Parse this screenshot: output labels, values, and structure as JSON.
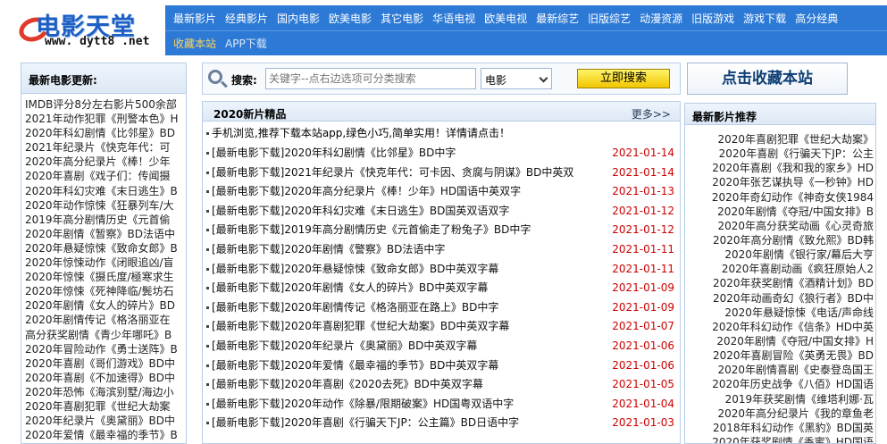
{
  "logo": {
    "cn": "电影天堂",
    "en": "www. dytt8 .net"
  },
  "topnav": [
    "最新影片",
    "经典影片",
    "国内电影",
    "欧美电影",
    "其它电影",
    "华语电视",
    "欧美电视",
    "最新综艺",
    "旧版综艺",
    "动漫资源",
    "旧版游戏",
    "游戏下载",
    "高分经典"
  ],
  "subnav": {
    "favorite": "收藏本站",
    "app": "APP下载"
  },
  "left": {
    "title": "最新电影更新:",
    "items": [
      "IMDB评分8分左右影片500余部",
      "2021年动作犯罪《刑警本色》H",
      "2020年科幻剧情《比邻星》BD",
      "2021年纪录片《快克年代：可",
      "2020年高分纪录片《棒！少年",
      "2020年喜剧《戏子们：传闻摄",
      "2020年科幻灾难《末日逃生》B",
      "2020年动作惊悚《狂暴列车/大",
      "2019年高分剧情历史《元首偷",
      "2020年剧情《暂察》BD法语中",
      "2020年悬疑惊悚《致命女郎》B",
      "2020年惊悚动作《闭眼追凶/盲",
      "2020年惊悚《摄氏度/極寒求生",
      "2020年惊悚《死神降临/鬓坊石",
      "2020年剧情《女人的碎片》BD",
      "2020年剧情传记《格洛丽亚在",
      "高分获奖剧情《青少年哪吒》B",
      "2020年冒险动作《勇士送阵》B",
      "2020年喜剧《哥们游戏》BD中",
      "2020年喜剧《不加速得》BD中",
      "2020年恐怖《海滨别墅/海边小",
      "2020年喜剧犯罪《世纪大劫案",
      "2020年纪录片《奥黛丽》BD中",
      "2020年爱情《最幸福的季节》B",
      "2020年喜剧《2020去死》BD"
    ]
  },
  "search": {
    "label": "搜索:",
    "placeholder": "关键字--点右边选项可分类搜索",
    "category": "电影",
    "button": "立即搜索"
  },
  "main": {
    "title": "2020新片精品",
    "more": "更多>>",
    "promo": "手机浏览,推荐下载本站app,绿色小巧,简单实用！详情请点击！",
    "rows": [
      {
        "text": "[最新电影下载]2020年科幻剧情《比邻星》BD中字",
        "date": "2021-01-14"
      },
      {
        "text": "[最新电影下载]2021年纪录片《快克年代：可卡因、贪腐与阴谋》BD中英双",
        "date": "2021-01-14"
      },
      {
        "text": "[最新电影下载]2020年高分纪录片《棒！少年》HD国语中英双字",
        "date": "2021-01-13"
      },
      {
        "text": "[最新电影下载]2020年科幻灾难《末日逃生》BD国英双语双字",
        "date": "2021-01-12"
      },
      {
        "text": "[最新电影下载]2019年高分剧情历史《元首偷走了粉兔子》BD中字",
        "date": "2021-01-12"
      },
      {
        "text": "[最新电影下载]2020年剧情《警察》BD法语中字",
        "date": "2021-01-11"
      },
      {
        "text": "[最新电影下载]2020年悬疑惊悚《致命女郎》BD中英双字幕",
        "date": "2021-01-11"
      },
      {
        "text": "[最新电影下载]2020年剧情《女人的碎片》BD中英双字幕",
        "date": "2021-01-09"
      },
      {
        "text": "[最新电影下载]2020年剧情传记《格洛丽亚在路上》BD中字",
        "date": "2021-01-09"
      },
      {
        "text": "[最新电影下载]2020年喜剧犯罪《世纪大劫案》BD中英双字幕",
        "date": "2021-01-07"
      },
      {
        "text": "[最新电影下载]2020年纪录片《奥黛丽》BD中英双字幕",
        "date": "2021-01-06"
      },
      {
        "text": "[最新电影下载]2020年爱情《最幸福的季节》BD中英双字幕",
        "date": "2021-01-06"
      },
      {
        "text": "[最新电影下载]2020年喜剧《2020去死》BD中英双字幕",
        "date": "2021-01-05"
      },
      {
        "text": "[最新电影下载]2020年动作《除暴/限期破案》HD国粤双语中字",
        "date": "2021-01-04"
      },
      {
        "text": "[最新电影下载]2020年喜剧《行骗天下JP：公主篇》BD日语中字",
        "date": "2021-01-03"
      }
    ]
  },
  "bookmark_button": "点击收藏本站",
  "right": {
    "title": "最新影片推荐",
    "items": [
      "2020年喜剧犯罪《世纪大劫案》",
      "2020年喜剧《行骗天下JP：公主",
      "2020年喜剧《我和我的家乡》HD",
      "2020年张艺谋执导《一秒钟》HD",
      "2020年奇幻动作《神奇女侠1984",
      "2020年剧情《夺冠/中国女排》B",
      "2020年高分获奖动画《心灵奇旅",
      "2020年高分剧情《致允熙》BD韩",
      "2020年剧情《银行家/幕后大亨",
      "2020年喜剧动画《疯狂原始人2",
      "2020年获奖剧情《酒精计划》BD",
      "2020年动画奇幻《狼行者》BD中",
      "2020年悬疑惊悚《电话/声命线",
      "2020年科幻动作《信条》HD中英",
      "2020年剧情《夺冠/中国女排》H",
      "2020年喜剧冒险《英勇无畏》BD",
      "2020年剧情喜剧《史泰登岛国王",
      "2020年历史战争《八佰》HD国语",
      "2019年获奖剧情《维塔利娜·瓦",
      "2020年高分纪录片《我的章鱼老",
      "2018年科幻动作《黑豹》BD国英",
      "2020年获奖剧情《香蜜》HD国语"
    ]
  }
}
